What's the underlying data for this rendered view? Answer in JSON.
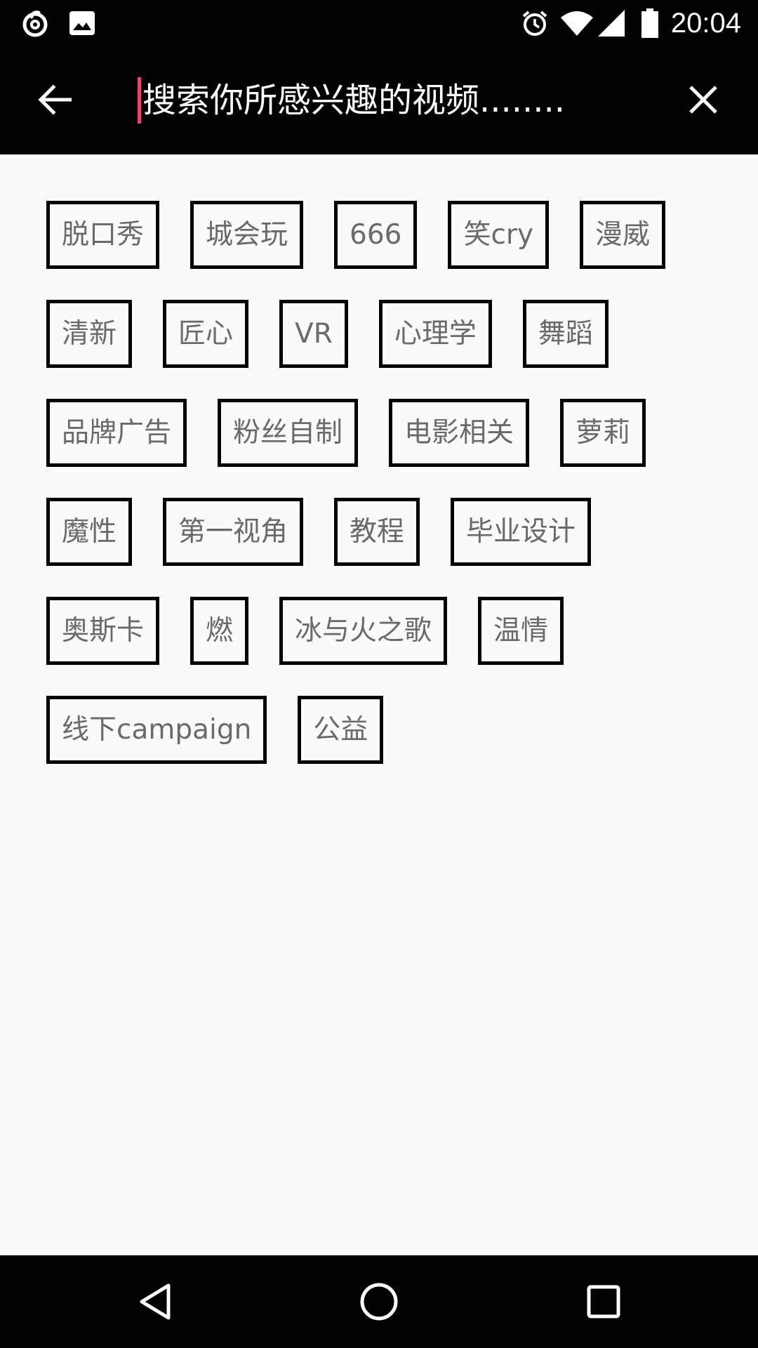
{
  "status_bar": {
    "time": "20:04",
    "left_icons": [
      "netease-music-icon",
      "image-icon"
    ],
    "right_icons": [
      "alarm-icon",
      "wifi-icon",
      "signal-icon",
      "battery-icon"
    ]
  },
  "search": {
    "placeholder": "搜索你所感兴趣的视频........",
    "value": "",
    "cursor_color": "#e4486f"
  },
  "tags": [
    [
      "脱口秀",
      "城会玩",
      "666",
      "笑cry",
      "漫威"
    ],
    [
      "清新",
      "匠心",
      "VR",
      "心理学",
      "舞蹈"
    ],
    [
      "品牌广告",
      "粉丝自制",
      "电影相关",
      "萝莉"
    ],
    [
      "魔性",
      "第一视角",
      "教程",
      "毕业设计"
    ],
    [
      "奥斯卡",
      "燃",
      "冰与火之歌",
      "温情"
    ],
    [
      "线下campaign",
      "公益"
    ]
  ],
  "colors": {
    "header_bg": "#000000",
    "page_bg": "#fafafa",
    "tag_border": "#000000",
    "tag_text": "#6a6a6a"
  },
  "nav_bar": {
    "icons": [
      "back-triangle-icon",
      "home-circle-icon",
      "recents-square-icon"
    ]
  }
}
